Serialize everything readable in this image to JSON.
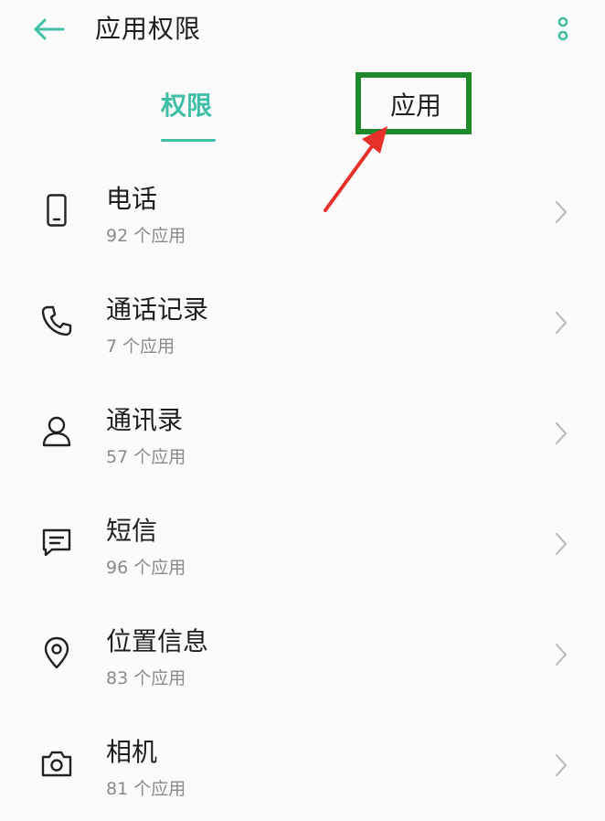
{
  "accent": "#3fbfa5",
  "header": {
    "title": "应用权限",
    "back_icon": "arrow-left-icon",
    "more_icon": "more-vertical-icon"
  },
  "tabs": [
    {
      "label": "权限",
      "active": true
    },
    {
      "label": "应用",
      "active": false
    }
  ],
  "permissions": [
    {
      "label": "电话",
      "count": "92 个应用",
      "icon": "phone-device-icon"
    },
    {
      "label": "通话记录",
      "count": "7 个应用",
      "icon": "phone-handset-icon"
    },
    {
      "label": "通讯录",
      "count": "57 个应用",
      "icon": "person-icon"
    },
    {
      "label": "短信",
      "count": "96 个应用",
      "icon": "message-icon"
    },
    {
      "label": "位置信息",
      "count": "83 个应用",
      "icon": "location-pin-icon"
    },
    {
      "label": "相机",
      "count": "81 个应用",
      "icon": "camera-icon"
    }
  ],
  "annotation": {
    "box_color": "#1f8a2c",
    "arrow_color": "#e8302a"
  }
}
